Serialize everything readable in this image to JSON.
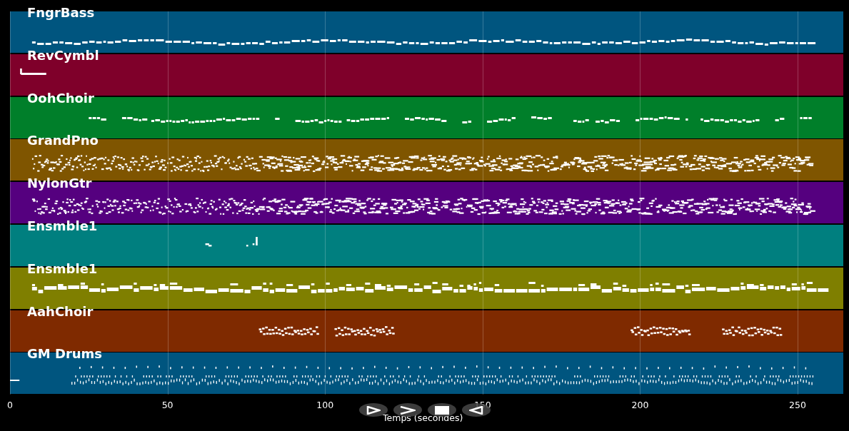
{
  "tracks": [
    {
      "name": "FngrBass",
      "color": "#00557f",
      "kind": "line"
    },
    {
      "name": "RevCymbl",
      "color": "#7f002a",
      "kind": "burst"
    },
    {
      "name": "OohChoir",
      "color": "#007f2a",
      "kind": "phrases"
    },
    {
      "name": "GrandPno",
      "color": "#7f5500",
      "kind": "dense"
    },
    {
      "name": "NylonGtr",
      "color": "#55007f",
      "kind": "dense"
    },
    {
      "name": "Ensmble1",
      "color": "#007f7f",
      "kind": "sparse"
    },
    {
      "name": "Ensmble1",
      "color": "#7f7f00",
      "kind": "chords"
    },
    {
      "name": "AahChoir",
      "color": "#7f2a00",
      "kind": "segments"
    },
    {
      "name": "GM Drums",
      "color": "#00557f",
      "kind": "drums"
    }
  ],
  "x_axis": {
    "ticks": [
      "0",
      "50",
      "100",
      "150",
      "200",
      "250"
    ],
    "label": "Temps (secondes)"
  }
}
